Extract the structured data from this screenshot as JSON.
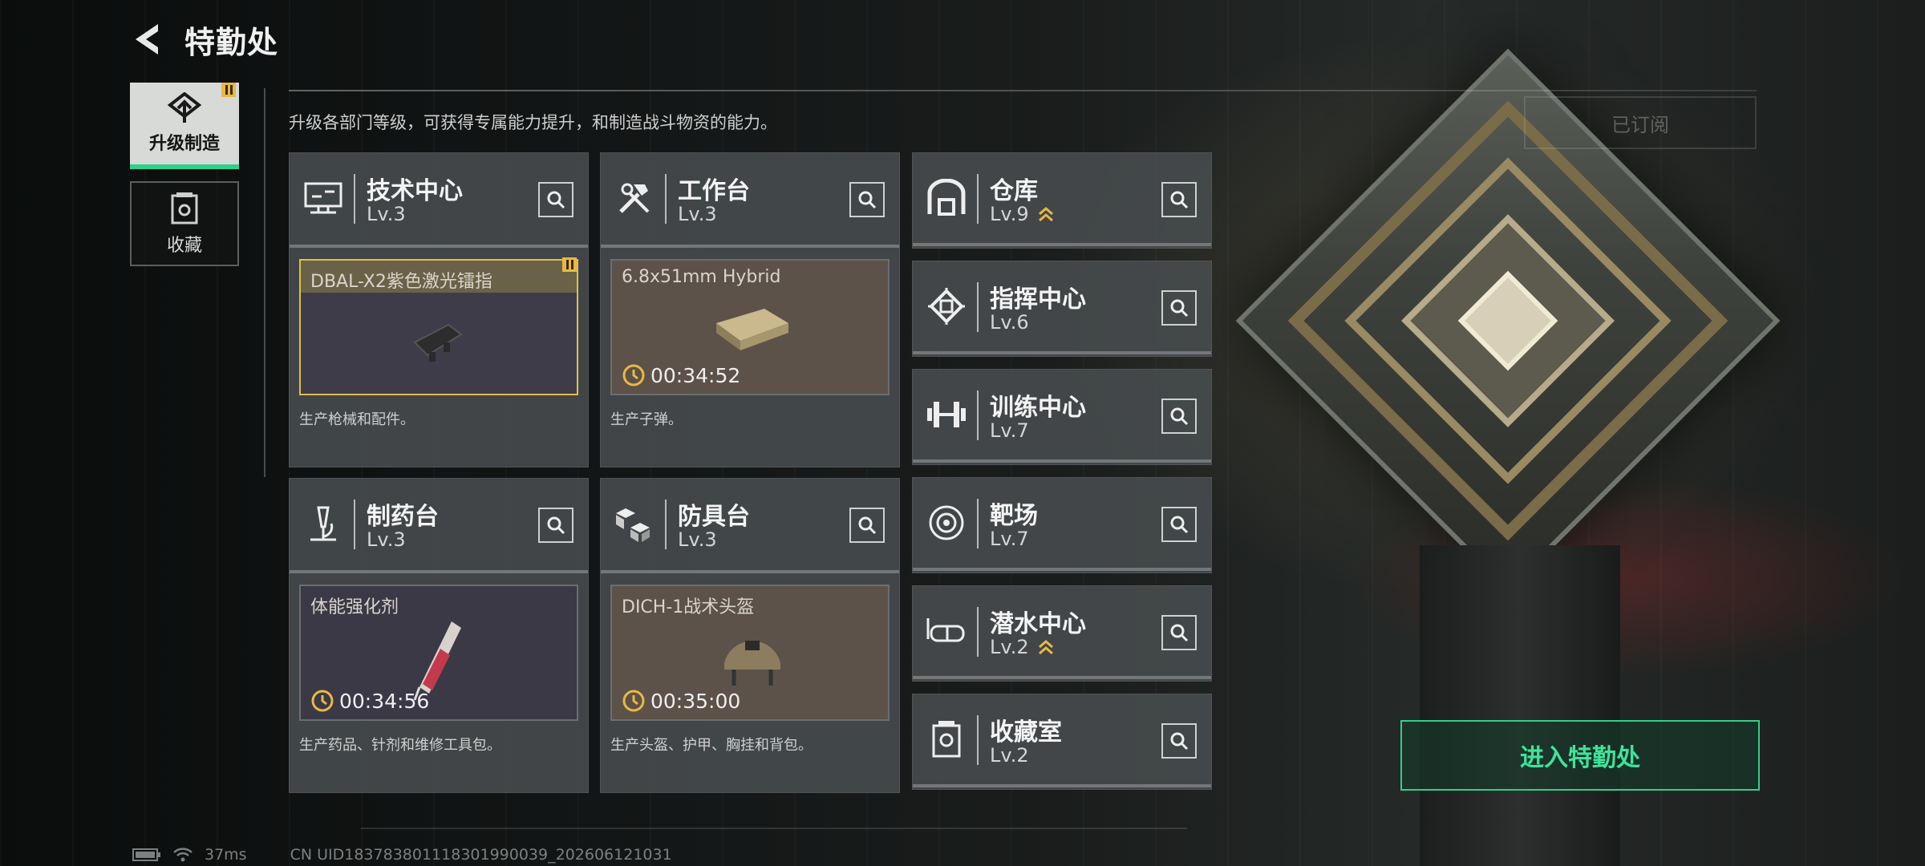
{
  "header": {
    "title": "特勤处"
  },
  "tabs": [
    {
      "label": "升级制造",
      "active": true,
      "badge": "warning"
    },
    {
      "label": "收藏",
      "active": false
    }
  ],
  "subtitle": "升级各部门等级，可获得专属能力提升，和制造战斗物资的能力。",
  "subscribed_label": "已订阅",
  "departments": {
    "tech": {
      "name": "技术中心",
      "level": "Lv.3",
      "icon": "monitor-icon",
      "product": "DBAL-X2紫色激光镭指",
      "desc": "生产枪械和配件。"
    },
    "workbench": {
      "name": "工作台",
      "level": "Lv.3",
      "icon": "hammer-wrench-icon",
      "product": "6.8x51mm Hybrid",
      "timer": "00:34:52",
      "desc": "生产子弹。"
    },
    "pharmacy": {
      "name": "制药台",
      "level": "Lv.3",
      "icon": "microscope-icon",
      "product": "体能强化剂",
      "timer": "00:34:56",
      "desc": "生产药品、针剂和维修工具包。"
    },
    "armor": {
      "name": "防具台",
      "level": "Lv.3",
      "icon": "cubes-icon",
      "product": "DICH-1战术头盔",
      "timer": "00:35:00",
      "desc": "生产头盔、护甲、胸挂和背包。"
    },
    "warehouse": {
      "name": "仓库",
      "level": "Lv.9",
      "icon": "warehouse-icon",
      "upgradable": true
    },
    "command": {
      "name": "指挥中心",
      "level": "Lv.6",
      "icon": "chip-icon"
    },
    "training": {
      "name": "训练中心",
      "level": "Lv.7",
      "icon": "dumbbell-icon"
    },
    "range": {
      "name": "靶场",
      "level": "Lv.7",
      "icon": "target-icon"
    },
    "diving": {
      "name": "潜水中心",
      "level": "Lv.2",
      "icon": "goggles-icon",
      "upgradable": true
    },
    "collection": {
      "name": "收藏室",
      "level": "Lv.2",
      "icon": "trophy-case-icon"
    }
  },
  "enter_button": "进入特勤处",
  "footer": {
    "ping": "37ms",
    "uid": "CN UID18378380111830199003​9_202606121031"
  },
  "colors": {
    "accent": "#2fd08b",
    "gold": "#e2bd4e",
    "warning": "#e8b845"
  }
}
